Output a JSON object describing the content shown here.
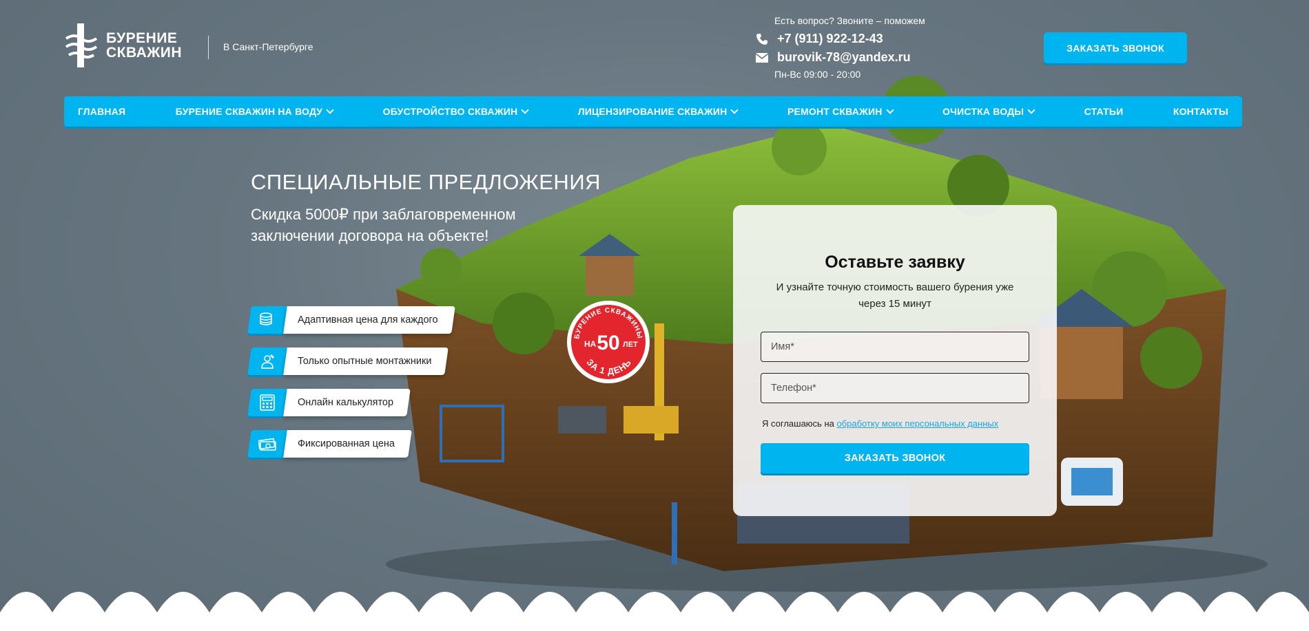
{
  "header": {
    "logo_line1": "БУРЕНИЕ",
    "logo_line2": "СКВАЖИН",
    "city": "В Санкт-Петербурге",
    "question": "Есть вопрос? Звоните – поможем",
    "phone": "+7 (911) 922-12-43",
    "email": "burovik-78@yandex.ru",
    "hours": "Пн-Вс 09:00 - 20:00",
    "call_button": "ЗАКАЗАТЬ ЗВОНОК"
  },
  "nav": {
    "items": [
      {
        "label": "ГЛАВНАЯ"
      },
      {
        "label": "БУРЕНИЕ СКВАЖИН НА ВОДУ"
      },
      {
        "label": "ОБУСТРОЙСТВО СКВАЖИН"
      },
      {
        "label": "ЛИЦЕНЗИРОВАНИЕ СКВАЖИН"
      },
      {
        "label": "РЕМОНТ СКВАЖИН"
      },
      {
        "label": "ОЧИСТКА ВОДЫ"
      },
      {
        "label": "СТАТЬИ"
      },
      {
        "label": "КОНТАКТЫ"
      }
    ]
  },
  "hero": {
    "title": "СПЕЦИАЛЬНЫЕ ПРЕДЛОЖЕНИЯ",
    "subtitle": "Скидка 5000₽ при заблаговременном заключении договора на объекте!"
  },
  "features": [
    {
      "label": "Адаптивная цена для каждого",
      "icon": "coins-icon"
    },
    {
      "label": "Только опытные монтажники",
      "icon": "worker-icon"
    },
    {
      "label": "Онлайн калькулятор",
      "icon": "calculator-icon"
    },
    {
      "label": "Фиксированная цена",
      "icon": "money-icon"
    }
  ],
  "badge": {
    "top_text": "БУРЕНИЕ СКВАЖИНЫ",
    "prefix": "НА",
    "number": "50",
    "suffix": "ЛЕТ",
    "bottom_text": "ЗА 1 ДЕНЬ"
  },
  "form": {
    "title": "Оставьте заявку",
    "subtitle": "И узнайте точную стоимость вашего бурения уже через 15 минут",
    "name_placeholder": "Имя*",
    "phone_placeholder": "Телефон*",
    "consent_text": "Я соглашаюсь на ",
    "consent_link": "обработку моих персональных данных",
    "submit": "ЗАКАЗАТЬ ЗВОНОК"
  },
  "colors": {
    "accent": "#00b4ef",
    "background": "#66757f",
    "badge_red": "#e3262e"
  }
}
